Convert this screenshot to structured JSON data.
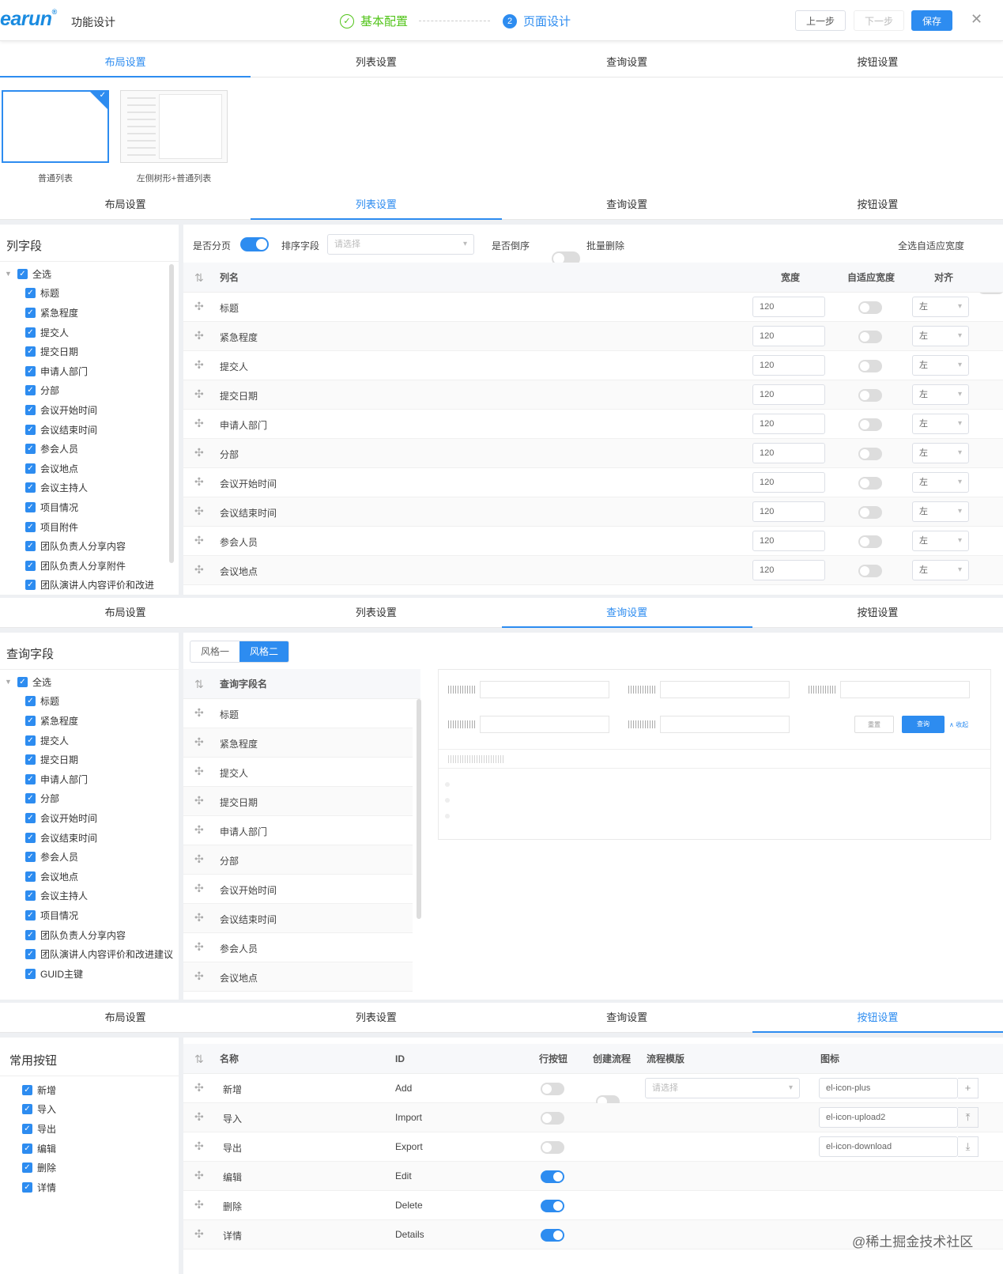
{
  "header": {
    "logo": "earun",
    "logo_mark": "®",
    "title": "功能设计",
    "step1": "基本配置",
    "step2_num": "2",
    "step2": "页面设计",
    "btn_prev": "上一步",
    "btn_next": "下一步",
    "btn_save": "保存"
  },
  "tabs": [
    "布局设置",
    "列表设置",
    "查询设置",
    "按钮设置"
  ],
  "layouts": [
    {
      "label": "普通列表"
    },
    {
      "label": "左侧树形+普通列表"
    }
  ],
  "list_panel": {
    "title": "列字段",
    "tree_all": "全选",
    "fields": [
      "标题",
      "紧急程度",
      "提交人",
      "提交日期",
      "申请人部门",
      "分部",
      "会议开始时间",
      "会议结束时间",
      "参会人员",
      "会议地点",
      "会议主持人",
      "项目情况",
      "项目附件",
      "团队负责人分享内容",
      "团队负责人分享附件",
      "团队演讲人内容评价和改进"
    ],
    "toolbar": {
      "paging": "是否分页",
      "sort_field": "排序字段",
      "sort_placeholder": "请选择",
      "desc": "是否倒序",
      "batch_del": "批量删除",
      "auto_width_all": "全选自适应宽度"
    },
    "headers": {
      "name": "列名",
      "width": "宽度",
      "auto": "自适应宽度",
      "align": "对齐"
    },
    "rows": [
      {
        "name": "标题",
        "width": "120",
        "align": "左"
      },
      {
        "name": "紧急程度",
        "width": "120",
        "align": "左"
      },
      {
        "name": "提交人",
        "width": "120",
        "align": "左"
      },
      {
        "name": "提交日期",
        "width": "120",
        "align": "左"
      },
      {
        "name": "申请人部门",
        "width": "120",
        "align": "左"
      },
      {
        "name": "分部",
        "width": "120",
        "align": "左"
      },
      {
        "name": "会议开始时间",
        "width": "120",
        "align": "左"
      },
      {
        "name": "会议结束时间",
        "width": "120",
        "align": "左"
      },
      {
        "name": "参会人员",
        "width": "120",
        "align": "左"
      },
      {
        "name": "会议地点",
        "width": "120",
        "align": "左"
      }
    ]
  },
  "query_panel": {
    "title": "查询字段",
    "tree_all": "全选",
    "fields": [
      "标题",
      "紧急程度",
      "提交人",
      "提交日期",
      "申请人部门",
      "分部",
      "会议开始时间",
      "会议结束时间",
      "参会人员",
      "会议地点",
      "会议主持人",
      "项目情况",
      "团队负责人分享内容",
      "团队演讲人内容评价和改进建议",
      "GUID主键"
    ],
    "style1": "风格一",
    "style2": "风格二",
    "col_header": "查询字段名",
    "rows": [
      "标题",
      "紧急程度",
      "提交人",
      "提交日期",
      "申请人部门",
      "分部",
      "会议开始时间",
      "会议结束时间",
      "参会人员",
      "会议地点"
    ],
    "preview": {
      "reset": "重置",
      "search": "查询",
      "collapse": "∧ 收起"
    }
  },
  "button_panel": {
    "title": "常用按钮",
    "items": [
      "新增",
      "导入",
      "导出",
      "编辑",
      "删除",
      "详情"
    ],
    "headers": {
      "name": "名称",
      "id": "ID",
      "row_btn": "行按钮",
      "create_flow": "创建流程",
      "flow_tpl": "流程模版",
      "icon": "图标"
    },
    "flow_placeholder": "请选择",
    "rows": [
      {
        "name": "新增",
        "id": "Add",
        "row_on": false,
        "icon": "el-icon-plus",
        "icon_glyph": "+"
      },
      {
        "name": "导入",
        "id": "Import",
        "row_on": false,
        "icon": "el-icon-upload2",
        "icon_glyph": "⤒"
      },
      {
        "name": "导出",
        "id": "Export",
        "row_on": false,
        "icon": "el-icon-download",
        "icon_glyph": "⤓"
      },
      {
        "name": "编辑",
        "id": "Edit",
        "row_on": true,
        "icon": "",
        "icon_glyph": ""
      },
      {
        "name": "删除",
        "id": "Delete",
        "row_on": true,
        "icon": "",
        "icon_glyph": ""
      },
      {
        "name": "详情",
        "id": "Details",
        "row_on": true,
        "icon": "",
        "icon_glyph": ""
      }
    ]
  },
  "watermark": "@稀土掘金技术社区",
  "colors": {
    "primary": "#2d8cf0",
    "success": "#52c41a"
  }
}
